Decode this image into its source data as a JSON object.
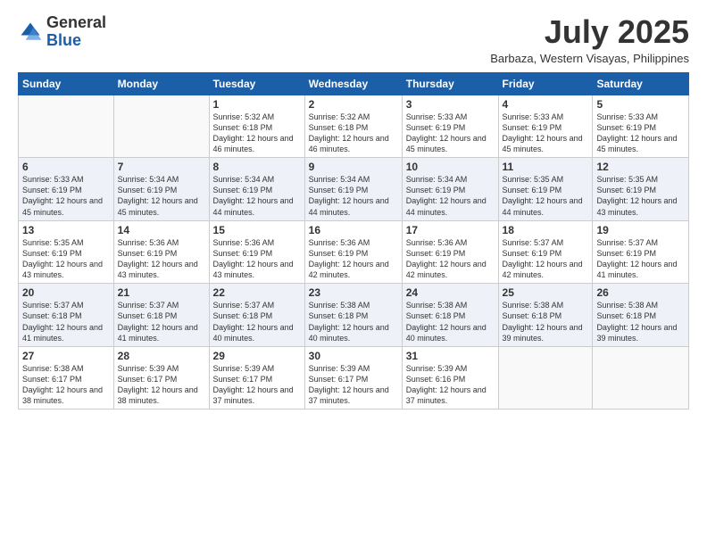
{
  "logo": {
    "general": "General",
    "blue": "Blue"
  },
  "title": "July 2025",
  "subtitle": "Barbaza, Western Visayas, Philippines",
  "days_of_week": [
    "Sunday",
    "Monday",
    "Tuesday",
    "Wednesday",
    "Thursday",
    "Friday",
    "Saturday"
  ],
  "weeks": [
    [
      {
        "day": "",
        "info": ""
      },
      {
        "day": "",
        "info": ""
      },
      {
        "day": "1",
        "info": "Sunrise: 5:32 AM\nSunset: 6:18 PM\nDaylight: 12 hours and 46 minutes."
      },
      {
        "day": "2",
        "info": "Sunrise: 5:32 AM\nSunset: 6:18 PM\nDaylight: 12 hours and 46 minutes."
      },
      {
        "day": "3",
        "info": "Sunrise: 5:33 AM\nSunset: 6:19 PM\nDaylight: 12 hours and 45 minutes."
      },
      {
        "day": "4",
        "info": "Sunrise: 5:33 AM\nSunset: 6:19 PM\nDaylight: 12 hours and 45 minutes."
      },
      {
        "day": "5",
        "info": "Sunrise: 5:33 AM\nSunset: 6:19 PM\nDaylight: 12 hours and 45 minutes."
      }
    ],
    [
      {
        "day": "6",
        "info": "Sunrise: 5:33 AM\nSunset: 6:19 PM\nDaylight: 12 hours and 45 minutes."
      },
      {
        "day": "7",
        "info": "Sunrise: 5:34 AM\nSunset: 6:19 PM\nDaylight: 12 hours and 45 minutes."
      },
      {
        "day": "8",
        "info": "Sunrise: 5:34 AM\nSunset: 6:19 PM\nDaylight: 12 hours and 44 minutes."
      },
      {
        "day": "9",
        "info": "Sunrise: 5:34 AM\nSunset: 6:19 PM\nDaylight: 12 hours and 44 minutes."
      },
      {
        "day": "10",
        "info": "Sunrise: 5:34 AM\nSunset: 6:19 PM\nDaylight: 12 hours and 44 minutes."
      },
      {
        "day": "11",
        "info": "Sunrise: 5:35 AM\nSunset: 6:19 PM\nDaylight: 12 hours and 44 minutes."
      },
      {
        "day": "12",
        "info": "Sunrise: 5:35 AM\nSunset: 6:19 PM\nDaylight: 12 hours and 43 minutes."
      }
    ],
    [
      {
        "day": "13",
        "info": "Sunrise: 5:35 AM\nSunset: 6:19 PM\nDaylight: 12 hours and 43 minutes."
      },
      {
        "day": "14",
        "info": "Sunrise: 5:36 AM\nSunset: 6:19 PM\nDaylight: 12 hours and 43 minutes."
      },
      {
        "day": "15",
        "info": "Sunrise: 5:36 AM\nSunset: 6:19 PM\nDaylight: 12 hours and 43 minutes."
      },
      {
        "day": "16",
        "info": "Sunrise: 5:36 AM\nSunset: 6:19 PM\nDaylight: 12 hours and 42 minutes."
      },
      {
        "day": "17",
        "info": "Sunrise: 5:36 AM\nSunset: 6:19 PM\nDaylight: 12 hours and 42 minutes."
      },
      {
        "day": "18",
        "info": "Sunrise: 5:37 AM\nSunset: 6:19 PM\nDaylight: 12 hours and 42 minutes."
      },
      {
        "day": "19",
        "info": "Sunrise: 5:37 AM\nSunset: 6:19 PM\nDaylight: 12 hours and 41 minutes."
      }
    ],
    [
      {
        "day": "20",
        "info": "Sunrise: 5:37 AM\nSunset: 6:18 PM\nDaylight: 12 hours and 41 minutes."
      },
      {
        "day": "21",
        "info": "Sunrise: 5:37 AM\nSunset: 6:18 PM\nDaylight: 12 hours and 41 minutes."
      },
      {
        "day": "22",
        "info": "Sunrise: 5:37 AM\nSunset: 6:18 PM\nDaylight: 12 hours and 40 minutes."
      },
      {
        "day": "23",
        "info": "Sunrise: 5:38 AM\nSunset: 6:18 PM\nDaylight: 12 hours and 40 minutes."
      },
      {
        "day": "24",
        "info": "Sunrise: 5:38 AM\nSunset: 6:18 PM\nDaylight: 12 hours and 40 minutes."
      },
      {
        "day": "25",
        "info": "Sunrise: 5:38 AM\nSunset: 6:18 PM\nDaylight: 12 hours and 39 minutes."
      },
      {
        "day": "26",
        "info": "Sunrise: 5:38 AM\nSunset: 6:18 PM\nDaylight: 12 hours and 39 minutes."
      }
    ],
    [
      {
        "day": "27",
        "info": "Sunrise: 5:38 AM\nSunset: 6:17 PM\nDaylight: 12 hours and 38 minutes."
      },
      {
        "day": "28",
        "info": "Sunrise: 5:39 AM\nSunset: 6:17 PM\nDaylight: 12 hours and 38 minutes."
      },
      {
        "day": "29",
        "info": "Sunrise: 5:39 AM\nSunset: 6:17 PM\nDaylight: 12 hours and 37 minutes."
      },
      {
        "day": "30",
        "info": "Sunrise: 5:39 AM\nSunset: 6:17 PM\nDaylight: 12 hours and 37 minutes."
      },
      {
        "day": "31",
        "info": "Sunrise: 5:39 AM\nSunset: 6:16 PM\nDaylight: 12 hours and 37 minutes."
      },
      {
        "day": "",
        "info": ""
      },
      {
        "day": "",
        "info": ""
      }
    ]
  ]
}
